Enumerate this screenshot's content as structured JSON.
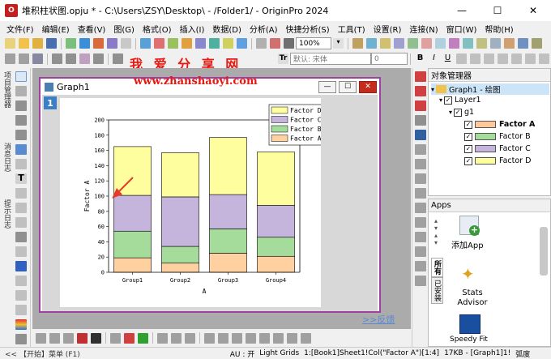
{
  "window": {
    "title": "堆积柱状图.opju * - C:\\Users\\ZSY\\Desktop\\ - /Folder1/ - OriginPro 2024",
    "minimize": "—",
    "maximize": "☐",
    "close": "✕"
  },
  "menu": [
    "文件(F)",
    "编辑(E)",
    "查看(V)",
    "图(G)",
    "格式(O)",
    "插入(I)",
    "数据(D)",
    "分析(A)",
    "快捷分析(S)",
    "工具(T)",
    "设置(R)",
    "连接(N)",
    "窗口(W)",
    "帮助(H)"
  ],
  "toolbar": {
    "zoom": "100%",
    "font_placeholder": "默认: 宋体",
    "font_size": "0",
    "bold": "B",
    "italic": "I",
    "underline": "U",
    "text_tool": "Tr"
  },
  "watermark": {
    "site_cn": "我 爱 分 享 网",
    "url": "www.zhanshaoyi.com"
  },
  "left_panel_labels": [
    "项目管理器",
    "消息日志",
    "提示日志"
  ],
  "graph_window": {
    "title": "Graph1",
    "layer_badge": "1",
    "feedback": ">>反馈"
  },
  "chart_data": {
    "type": "bar",
    "stacked": true,
    "categories": [
      "Group1",
      "Group2",
      "Group3",
      "Group4"
    ],
    "series": [
      {
        "name": "Factor A",
        "color": "#ffd0a0",
        "values": [
          19,
          12,
          25,
          21
        ]
      },
      {
        "name": "Factor B",
        "color": "#a6dc9b",
        "values": [
          35,
          22,
          32,
          25
        ]
      },
      {
        "name": "Factor C",
        "color": "#c5b5dc",
        "values": [
          47,
          65,
          45,
          42
        ]
      },
      {
        "name": "Factor D",
        "color": "#fffe9e",
        "values": [
          64,
          58,
          75,
          70
        ]
      }
    ],
    "xlabel": "A",
    "ylabel": "Factor A",
    "ylim": [
      0,
      200
    ],
    "yticks": [
      0,
      20,
      40,
      60,
      80,
      100,
      120,
      140,
      160,
      180,
      200
    ],
    "legend_placement": "top-right",
    "legend_order": [
      "Factor D",
      "Factor C",
      "Factor B",
      "Factor A"
    ],
    "annotation_color": "#e83a2a"
  },
  "object_manager": {
    "title": "对象管理器",
    "root": "Graph1 - 绘图",
    "layer": "Layer1",
    "group": "g1",
    "items": [
      {
        "label": "Factor A",
        "color": "#ffc89a",
        "bold": true
      },
      {
        "label": "Factor B",
        "color": "#a6dc9b",
        "bold": false
      },
      {
        "label": "Factor C",
        "color": "#c5b5dc",
        "bold": false
      },
      {
        "label": "Factor D",
        "color": "#fffe9e",
        "bold": false
      }
    ]
  },
  "apps": {
    "title": "Apps",
    "tab_all": "所有",
    "tab_installed": "已安装",
    "items": [
      {
        "label": "添加App"
      },
      {
        "label": "Stats Advisor"
      },
      {
        "label": "Speedy Fit"
      }
    ]
  },
  "statusbar": {
    "start": "<< 【开始】菜单 (F1)",
    "au": "AU : 开",
    "grids": "Light Grids",
    "ref": "1:[Book1]Sheet1!Col(\"Factor A\")[1:4]",
    "size": "17KB - [Graph1]1!",
    "angle": "弧度"
  }
}
